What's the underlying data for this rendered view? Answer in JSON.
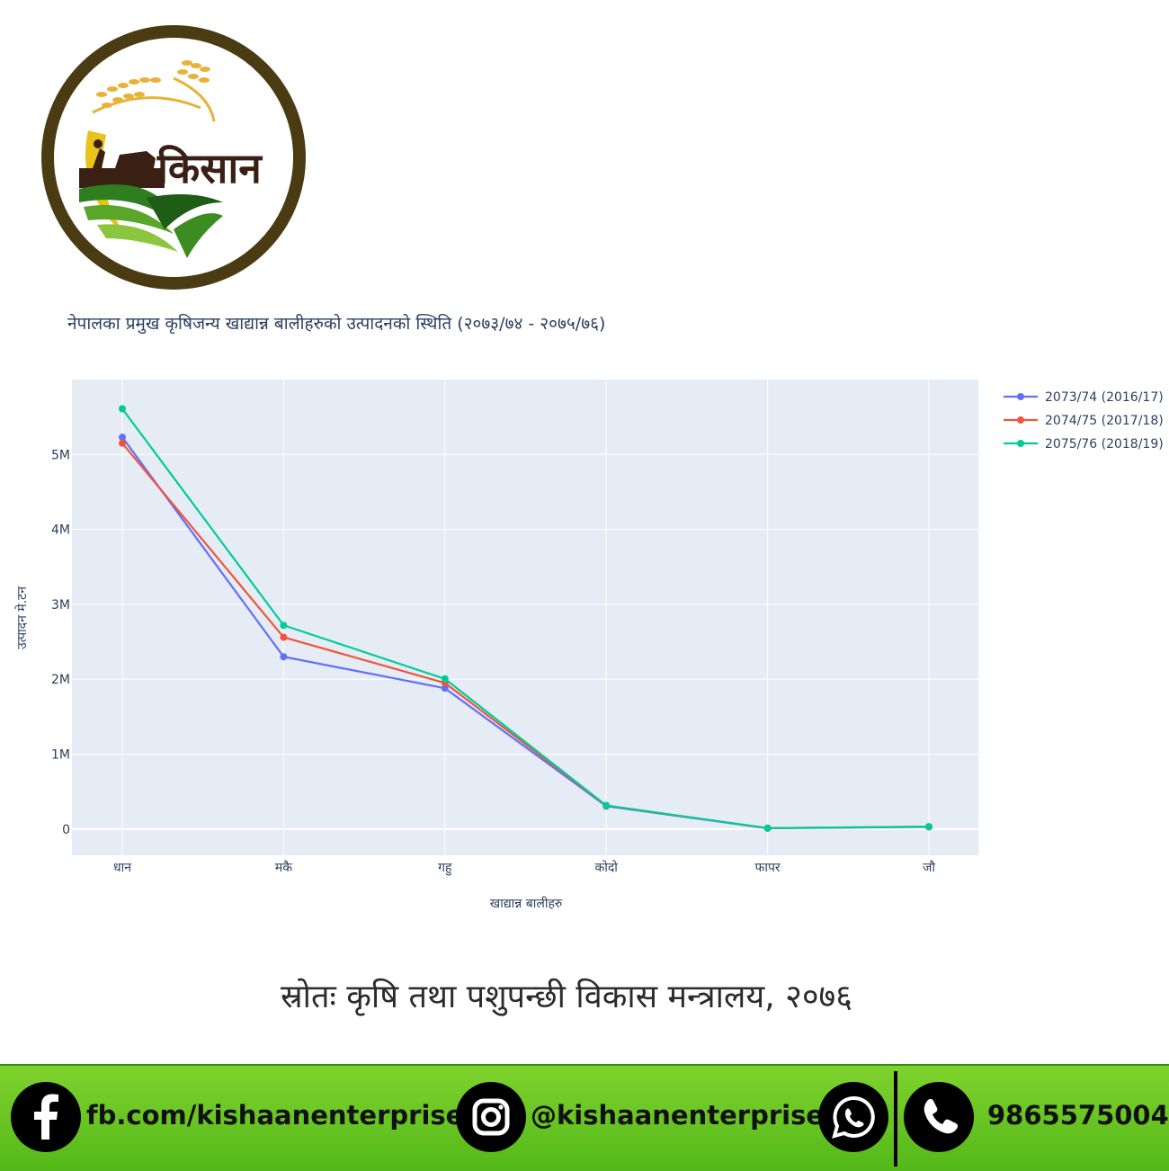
{
  "logo": {
    "brand_text": "किसान"
  },
  "chart_title": "नेपालका प्रमुख कृषिजन्य खाद्यान्न बालीहरुको उत्पादनको स्थिति (२०७३/७४ - २०७५/७६)",
  "chart_data": {
    "type": "line",
    "title": "नेपालका प्रमुख कृषिजन्य खाद्यान्न बालीहरुको उत्पादनको स्थिति (२०७३/७४ - २०७५/७६)",
    "xlabel": "खाद्यान्न बालीहरु",
    "ylabel": "उत्पादन मे.टन",
    "categories": [
      "धान",
      "मकै",
      "गहु",
      "कोदो",
      "फापर",
      "जौ"
    ],
    "ylim": [
      -350000,
      6000000
    ],
    "yticks": [
      0,
      1000000,
      2000000,
      3000000,
      4000000,
      5000000
    ],
    "ytick_labels": [
      "0",
      "1M",
      "2M",
      "3M",
      "4M",
      "5M"
    ],
    "grid": true,
    "legend_position": "top-right",
    "series": [
      {
        "name": "2073/74 (2016/17)",
        "color": "#636efa",
        "values": [
          5230000,
          2300000,
          1880000,
          306000,
          11500,
          29000
        ]
      },
      {
        "name": "2074/75 (2017/18)",
        "color": "#ef553b",
        "values": [
          5150000,
          2560000,
          1950000,
          313000,
          12000,
          31000
        ]
      },
      {
        "name": "2075/76 (2018/19)",
        "color": "#00cc96",
        "values": [
          5610000,
          2720000,
          2005000,
          315000,
          12500,
          33000
        ]
      }
    ]
  },
  "source_text": "स्रोतः कृषि तथा पशुपन्छी विकास मन्त्रालय, २०७६",
  "footer": {
    "facebook_text": "fb.com/kishaanenterprise",
    "instagram_text": "@kishaanenterprise",
    "phone_text": "9865575004",
    "icons": [
      "facebook-icon",
      "instagram-icon",
      "whatsapp-icon",
      "phone-icon"
    ]
  }
}
